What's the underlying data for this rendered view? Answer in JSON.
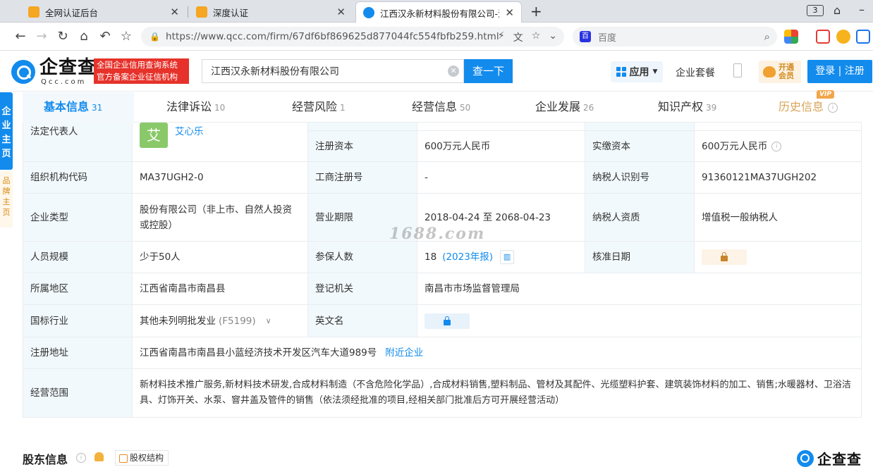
{
  "browser": {
    "tabs": [
      {
        "title": "全网认证后台",
        "close": "✕",
        "favicon_color": "#f5a623"
      },
      {
        "title": "深度认证",
        "close": "✕",
        "favicon_color": "#f5a623"
      },
      {
        "title": "江西汉永新材料股份有限公司-汉",
        "close": "✕",
        "favicon_color": "#128bed"
      }
    ],
    "new_tab": "+",
    "tab_count": "3",
    "url": "https://www.qcc.com/firm/67df6bf869625d877044fc554fbfb259.html",
    "search_placeholder": "百度",
    "baidu_mark": "百"
  },
  "site": {
    "logo_text": "企查查",
    "logo_sub": "Qcc.com",
    "slogan_line1": "全国企业信用查询系统",
    "slogan_line2": "官方备案企业征信机构",
    "search_value": "江西汉永新材料股份有限公司",
    "search_clear": "✕",
    "search_button": "查一下",
    "app_label": "应用",
    "packages_label": "企业套餐",
    "vip_line1": "开通",
    "vip_line2": "会员",
    "login_label": "登录 | 注册"
  },
  "side": {
    "blue_text": "企\n业\n主\n页",
    "orange_text": "品\n牌\n主\n页"
  },
  "tabs": [
    {
      "label": "基本信息",
      "count": "31"
    },
    {
      "label": "法律诉讼",
      "count": "10"
    },
    {
      "label": "经营风险",
      "count": "1"
    },
    {
      "label": "经营信息",
      "count": "50"
    },
    {
      "label": "企业发展",
      "count": "26"
    },
    {
      "label": "知识产权",
      "count": "39"
    },
    {
      "label": "历史信息",
      "count": ""
    }
  ],
  "vip_tag": "VIP",
  "info_mark": "i",
  "info": {
    "legal_rep_label": "法定代表人",
    "legal_rep_avatar": "艾",
    "legal_rep_name": "艾心乐",
    "reg_capital_label": "注册资本",
    "reg_capital": "600万元人民币",
    "paid_capital_label": "实缴资本",
    "paid_capital": "600万元人民币",
    "org_code_label": "组织机构代码",
    "org_code": "MA37UGH2-0",
    "biz_reg_no_label": "工商注册号",
    "biz_reg_no": "-",
    "taxpayer_id_label": "纳税人识别号",
    "taxpayer_id": "91360121MA37UGH202",
    "company_type_label": "企业类型",
    "company_type": "股份有限公司（非上市、自然人投资或控股）",
    "term_label": "营业期限",
    "term": "2018-04-24 至 2068-04-23",
    "taxpayer_qual_label": "纳税人资质",
    "taxpayer_qual": "增值税一般纳税人",
    "staff_label": "人员规模",
    "staff": "少于50人",
    "insured_label": "参保人数",
    "insured": "18",
    "insured_year": "(2023年报)",
    "approval_label": "核准日期",
    "region_label": "所属地区",
    "region": "江西省南昌市南昌县",
    "authority_label": "登记机关",
    "authority": "南昌市市场监督管理局",
    "industry_label": "国标行业",
    "industry": "其他未列明批发业",
    "industry_code": "(F5199)",
    "english_label": "英文名",
    "address_label": "注册地址",
    "address": "江西省南昌市南昌县小蓝经济技术开发区汽车大道989号",
    "nearby": "附近企业",
    "scope_label": "经营范围",
    "scope": "新材料技术推广服务,新材料技术研发,合成材料制造（不含危险化学品）,合成材料销售,塑料制品、管材及其配件、光缆塑料护套、建筑装饰材料的加工、销售;水暖器材、卫浴洁具、灯饰开关、水泵、窨井盖及管件的销售（依法须经批准的项目,经相关部门批准后方可开展经营活动）"
  },
  "watermark": "1688.com",
  "bottom": {
    "shareholders_title": "股东信息",
    "equity_label": "股权结构",
    "footer_logo": "企查查"
  }
}
